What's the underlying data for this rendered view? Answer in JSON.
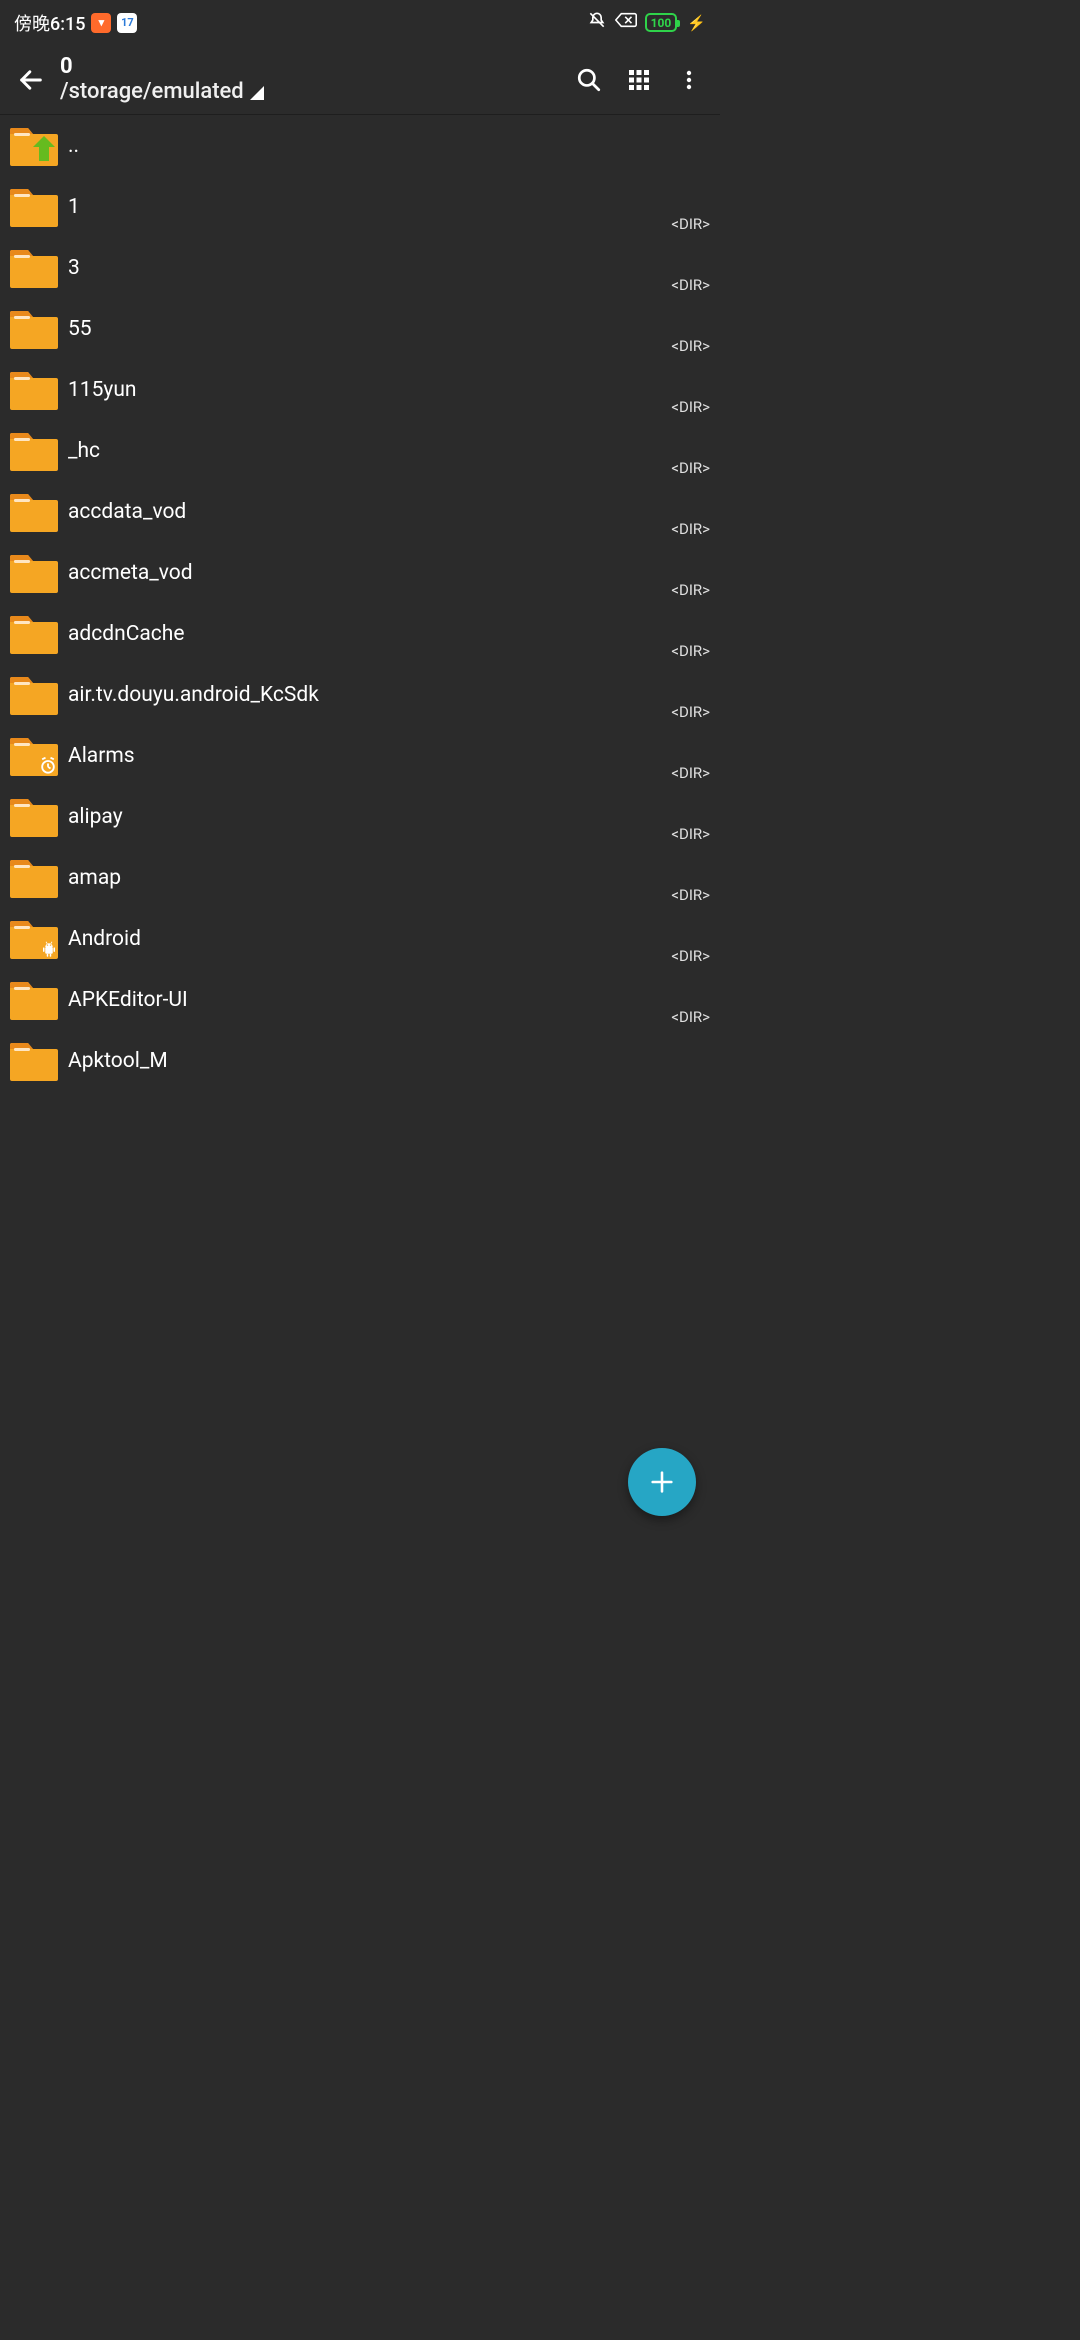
{
  "status": {
    "clock": "傍晚6:15",
    "battery_text": "100"
  },
  "toolbar": {
    "title": "0",
    "path": "/storage/emulated"
  },
  "dir_tag": "<DIR>",
  "entries": [
    {
      "name": "..",
      "type": "up",
      "show_dir": false
    },
    {
      "name": "1",
      "type": "folder",
      "show_dir": true
    },
    {
      "name": "3",
      "type": "folder",
      "show_dir": true
    },
    {
      "name": "55",
      "type": "folder",
      "show_dir": true
    },
    {
      "name": "115yun",
      "type": "folder",
      "show_dir": true
    },
    {
      "name": "_hc",
      "type": "folder",
      "show_dir": true
    },
    {
      "name": "accdata_vod",
      "type": "folder",
      "show_dir": true
    },
    {
      "name": "accmeta_vod",
      "type": "folder",
      "show_dir": true
    },
    {
      "name": "adcdnCache",
      "type": "folder",
      "show_dir": true
    },
    {
      "name": "air.tv.douyu.android_KcSdk",
      "type": "folder",
      "show_dir": true
    },
    {
      "name": "Alarms",
      "type": "folder",
      "show_dir": true,
      "overlay": "clock"
    },
    {
      "name": "alipay",
      "type": "folder",
      "show_dir": true
    },
    {
      "name": "amap",
      "type": "folder",
      "show_dir": true
    },
    {
      "name": "Android",
      "type": "folder",
      "show_dir": true,
      "overlay": "android"
    },
    {
      "name": "APKEditor-UI",
      "type": "folder",
      "show_dir": true
    },
    {
      "name": "Apktool_M",
      "type": "folder",
      "show_dir": false
    }
  ]
}
